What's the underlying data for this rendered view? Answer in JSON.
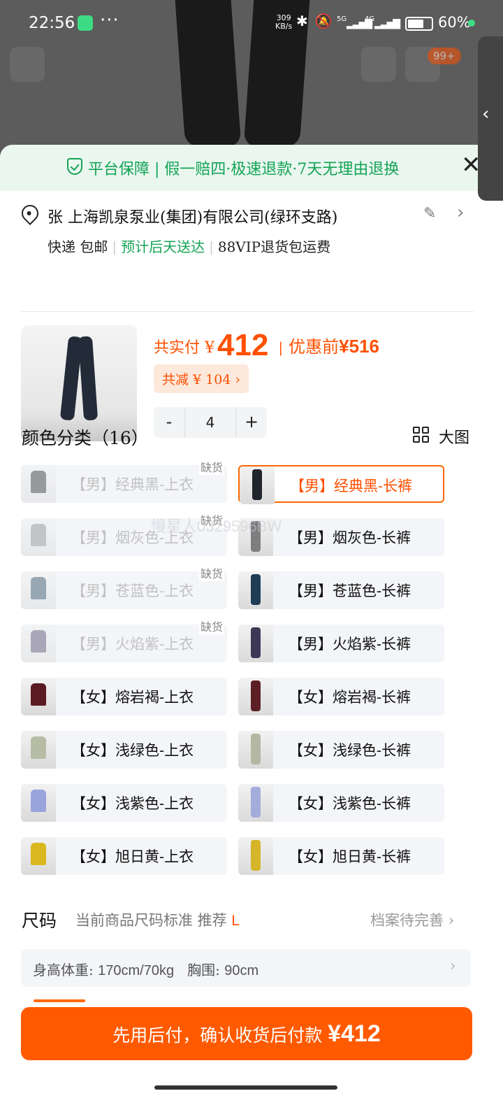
{
  "status": {
    "time": "22:56",
    "net_speed_value": "309",
    "net_speed_unit": "KB/s",
    "signal1": "5G",
    "signal2": "4G",
    "battery": "60%"
  },
  "cart_badge": "99+",
  "guarantee": {
    "text": "平台保障 | 假一赔四·极速退款·7天无理由退换",
    "close_icon": "close-icon"
  },
  "address": {
    "line1": "张 上海凯泉泵业(集团)有限公司(绿环支路)",
    "shipping": "快递 包邮",
    "eta": "预计后天送达",
    "vip": "88VIP退货包运费"
  },
  "price": {
    "paid_label": "共实付 ¥",
    "paid_amount": "412",
    "pipe": "|",
    "before_label": "优惠前",
    "before_amount": "¥516",
    "saving": "共减 ¥ 104 ›"
  },
  "stepper": {
    "minus": "-",
    "qty": "4",
    "plus": "+"
  },
  "color_section": {
    "title": "颜色分类（16）",
    "big_view": "大图",
    "out_of_stock": "缺货",
    "items": [
      {
        "label": "【男】经典黑-上衣",
        "oos": true,
        "color": "#2a2a2e",
        "kind": "top"
      },
      {
        "label": "【男】经典黑-长裤",
        "oos": false,
        "selected": true,
        "color": "#20252d",
        "kind": "pant"
      },
      {
        "label": "【男】烟灰色-上衣",
        "oos": true,
        "color": "#8a8a8a",
        "kind": "top"
      },
      {
        "label": "【男】烟灰色-长裤",
        "oos": false,
        "color": "#7e7e80",
        "kind": "pant"
      },
      {
        "label": "【男】苍蓝色-上衣",
        "oos": true,
        "color": "#2c4a63",
        "kind": "top"
      },
      {
        "label": "【男】苍蓝色-长裤",
        "oos": false,
        "color": "#1f3c55",
        "kind": "pant"
      },
      {
        "label": "【男】火焰紫-上衣",
        "oos": true,
        "color": "#504a6a",
        "kind": "top"
      },
      {
        "label": "【男】火焰紫-长裤",
        "oos": false,
        "color": "#3c3856",
        "kind": "pant"
      },
      {
        "label": "【女】熔岩褐-上衣",
        "oos": false,
        "color": "#5a1a22",
        "kind": "top"
      },
      {
        "label": "【女】熔岩褐-长裤",
        "oos": false,
        "color": "#5c1f26",
        "kind": "pant"
      },
      {
        "label": "【女】浅绿色-上衣",
        "oos": false,
        "color": "#b7bda5",
        "kind": "top"
      },
      {
        "label": "【女】浅绿色-长裤",
        "oos": false,
        "color": "#b2b8a2",
        "kind": "pant"
      },
      {
        "label": "【女】浅紫色-上衣",
        "oos": false,
        "color": "#9aa4dc",
        "kind": "top"
      },
      {
        "label": "【女】浅紫色-长裤",
        "oos": false,
        "color": "#a4acdc",
        "kind": "pant"
      },
      {
        "label": "【女】旭日黄-上衣",
        "oos": false,
        "color": "#d8b81e",
        "kind": "top"
      },
      {
        "label": "【女】旭日黄-长裤",
        "oos": false,
        "color": "#d6b52a",
        "kind": "pant"
      }
    ]
  },
  "size_section": {
    "title": "尺码",
    "hint": "当前商品尺码标准 推荐",
    "recommended": "L",
    "profile": "档案待完善 ›"
  },
  "body_info": {
    "height_weight_label": "身高体重:",
    "height_weight_value": "170cm/70kg",
    "chest_label": "胸围:",
    "chest_value": "90cm"
  },
  "pay_button": {
    "label": "先用后付，确认收货后付款 ",
    "amount": "¥412"
  },
  "watermark": "慢星人0329596BW",
  "accent": "#ff5000",
  "green": "#14a356"
}
